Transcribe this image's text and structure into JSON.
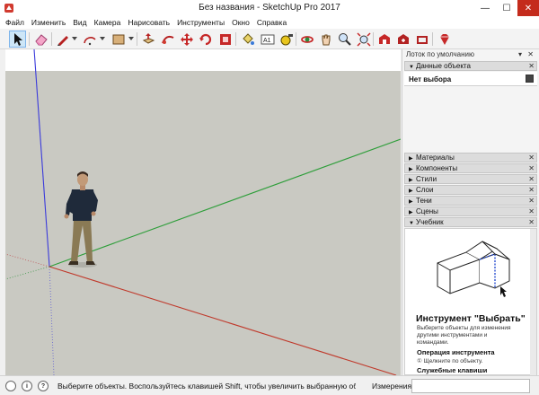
{
  "window": {
    "title": "Без названия - SketchUp Pro 2017",
    "min_glyph": "—",
    "max_glyph": "☐",
    "close_glyph": "✕"
  },
  "menu": [
    {
      "label": "Файл"
    },
    {
      "label": "Изменить"
    },
    {
      "label": "Вид"
    },
    {
      "label": "Камера"
    },
    {
      "label": "Нарисовать"
    },
    {
      "label": "Инструменты"
    },
    {
      "label": "Окно"
    },
    {
      "label": "Справка"
    }
  ],
  "toolbar": {
    "tools": [
      {
        "icon": "select-arrow-icon",
        "active": true
      },
      {
        "icon": "eraser-icon"
      },
      {
        "icon": "pencil-line-icon"
      },
      {
        "icon": "arc-icon"
      },
      {
        "icon": "rectangle-icon"
      },
      {
        "icon": "push-pull-icon"
      },
      {
        "icon": "follow-me-icon"
      },
      {
        "icon": "move-icon"
      },
      {
        "icon": "rotate-icon"
      },
      {
        "icon": "scale-icon"
      },
      {
        "icon": "paint-bucket-icon"
      },
      {
        "icon": "tape-measure-icon"
      },
      {
        "icon": "text-icon"
      },
      {
        "icon": "protractor-icon"
      },
      {
        "icon": "orbit-icon"
      },
      {
        "icon": "pan-icon"
      },
      {
        "icon": "zoom-icon"
      },
      {
        "icon": "zoom-extents-icon"
      },
      {
        "icon": "3d-warehouse-icon"
      },
      {
        "icon": "extension-warehouse-icon"
      },
      {
        "icon": "layout-icon"
      },
      {
        "icon": "ruby-console-icon"
      }
    ]
  },
  "tray": {
    "title": "Лоток по умолчанию",
    "head_buttons": "▾ ✕",
    "panels": [
      {
        "label": "Данные объекта",
        "expanded": true
      },
      {
        "label": "Материалы",
        "expanded": false
      },
      {
        "label": "Компоненты",
        "expanded": false
      },
      {
        "label": "Стили",
        "expanded": false
      },
      {
        "label": "Слои",
        "expanded": false
      },
      {
        "label": "Тени",
        "expanded": false
      },
      {
        "label": "Сцены",
        "expanded": false
      },
      {
        "label": "Учебник",
        "expanded": true
      }
    ],
    "entity_info": {
      "selection": "Нет выбора"
    },
    "tutorial": {
      "title": "Инструмент \"Выбрать\"",
      "description": "Выберите объекты для изменения другими инструментами и командами.",
      "operation_heading": "Операция инструмента",
      "operation_step": "① Щелкните по объекту.",
      "keys_heading": "Служебные клавиши"
    },
    "expanded_glyph": "▼",
    "collapsed_glyph": "▶",
    "close_glyph": "✕"
  },
  "status": {
    "icons": [
      "geo-location-icon",
      "credits-icon",
      "help-icon"
    ],
    "icon_glyphs": [
      "",
      "i",
      "?"
    ],
    "message": "Выберите объекты. Воспользуйтесь клавишей Shift, чтобы увеличить выбранную область. Пе...",
    "measure_label": "Измерения",
    "measure_value": ""
  },
  "colors": {
    "viewport_ground": "#c9c9c2",
    "sky": "#ffffff",
    "red_axis": "#c0392b",
    "green_axis": "#2e9e3a",
    "blue_axis": "#3a3adb",
    "close_button": "#c42b1c"
  }
}
